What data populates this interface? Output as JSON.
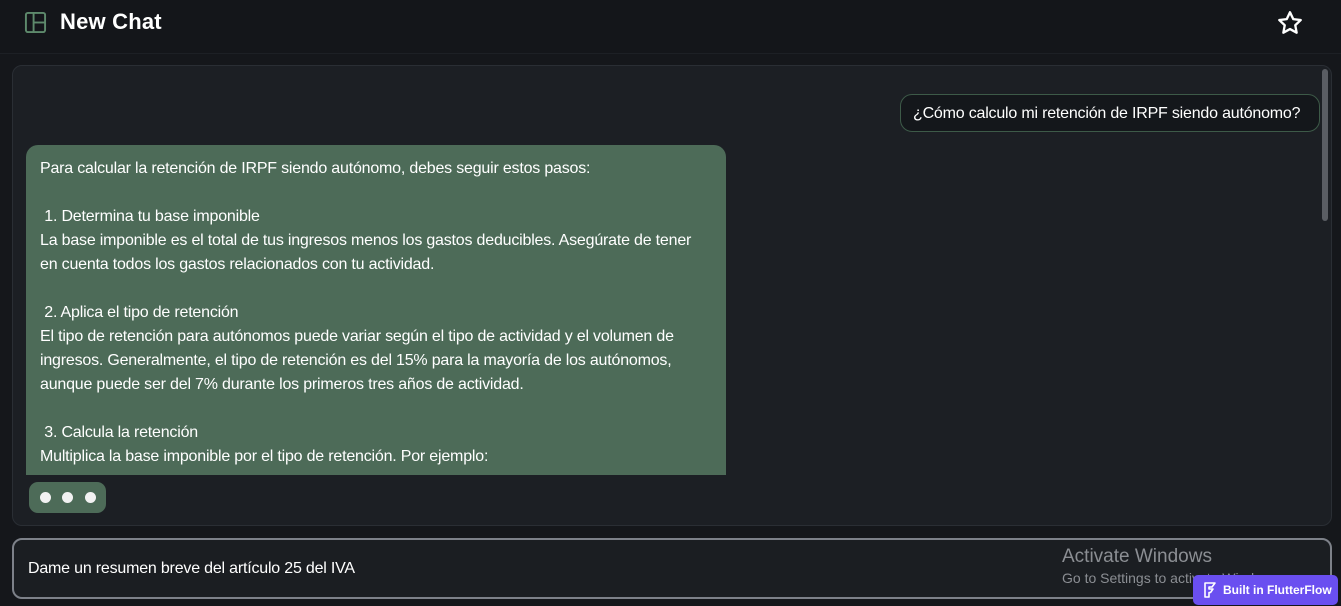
{
  "header": {
    "title": "New Chat",
    "menu_icon": "layout-sidebar-icon",
    "favorite_icon": "star-outline-icon"
  },
  "chat": {
    "user_message": "¿Cómo calculo mi retención de IRPF siendo autónomo?",
    "assistant_message": "Para calcular la retención de IRPF siendo autónomo, debes seguir estos pasos:\n\n 1. Determina tu base imponible\nLa base imponible es el total de tus ingresos menos los gastos deducibles. Asegúrate de tener en cuenta todos los gastos relacionados con tu actividad.\n\n 2. Aplica el tipo de retención\nEl tipo de retención para autónomos puede variar según el tipo de actividad y el volumen de ingresos. Generalmente, el tipo de retención es del 15% para la mayoría de los autónomos, aunque puede ser del 7% durante los primeros tres años de actividad.\n\n 3. Calcula la retención\nMultiplica la base imponible por el tipo de retención. Por ejemplo:",
    "typing_indicator_icon": "typing-dots-icon"
  },
  "input": {
    "value": "Dame un resumen breve del artículo 25 del IVA"
  },
  "overlay": {
    "activate_title": "Activate Windows",
    "activate_sub": "Go to Settings to activate Windows.",
    "badge_label": "Built in FlutterFlow",
    "badge_icon": "flutterflow-logo-icon"
  },
  "colors": {
    "accent_green": "#4d6b58",
    "user_bubble_border": "#3d5a48",
    "badge_purple": "#6a4ff0",
    "menu_icon": "#5e8a6c"
  }
}
